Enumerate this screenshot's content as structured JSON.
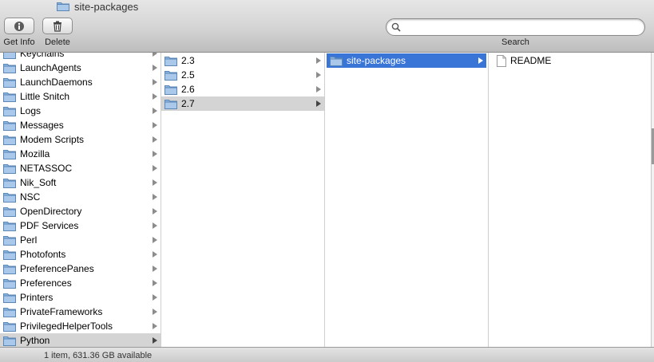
{
  "window": {
    "title": "site-packages"
  },
  "toolbar": {
    "get_info_label": "Get Info",
    "delete_label": "Delete",
    "search_label": "Search",
    "search_value": ""
  },
  "columns": {
    "col1": {
      "items": [
        {
          "label": "Keychains",
          "selected": "none"
        },
        {
          "label": "LaunchAgents",
          "selected": "none"
        },
        {
          "label": "LaunchDaemons",
          "selected": "none"
        },
        {
          "label": "Little Snitch",
          "selected": "none"
        },
        {
          "label": "Logs",
          "selected": "none"
        },
        {
          "label": "Messages",
          "selected": "none"
        },
        {
          "label": "Modem Scripts",
          "selected": "none"
        },
        {
          "label": "Mozilla",
          "selected": "none"
        },
        {
          "label": "NETASSOC",
          "selected": "none"
        },
        {
          "label": "Nik_Soft",
          "selected": "none"
        },
        {
          "label": "NSC",
          "selected": "none"
        },
        {
          "label": "OpenDirectory",
          "selected": "none"
        },
        {
          "label": "PDF Services",
          "selected": "none"
        },
        {
          "label": "Perl",
          "selected": "none"
        },
        {
          "label": "Photofonts",
          "selected": "none"
        },
        {
          "label": "PreferencePanes",
          "selected": "none"
        },
        {
          "label": "Preferences",
          "selected": "none"
        },
        {
          "label": "Printers",
          "selected": "none"
        },
        {
          "label": "PrivateFrameworks",
          "selected": "none"
        },
        {
          "label": "PrivilegedHelperTools",
          "selected": "none"
        },
        {
          "label": "Python",
          "selected": "gray"
        }
      ]
    },
    "col2": {
      "items": [
        {
          "label": "2.3",
          "selected": "none"
        },
        {
          "label": "2.5",
          "selected": "none"
        },
        {
          "label": "2.6",
          "selected": "none"
        },
        {
          "label": "2.7",
          "selected": "gray"
        }
      ]
    },
    "col3": {
      "items": [
        {
          "label": "site-packages",
          "selected": "blue"
        }
      ]
    },
    "col4": {
      "items": [
        {
          "label": "README",
          "icon": "document-icon"
        }
      ]
    }
  },
  "icons": {
    "get_info": "info-icon",
    "delete": "trash-icon",
    "search": "search-icon",
    "folder": "folder-icon"
  },
  "colors": {
    "selection_active": "#3875d7",
    "selection_inactive": "#d4d4d4",
    "folder_blue": "#7fa9d6"
  },
  "status": {
    "text": "1 item, 631.36 GB available"
  }
}
